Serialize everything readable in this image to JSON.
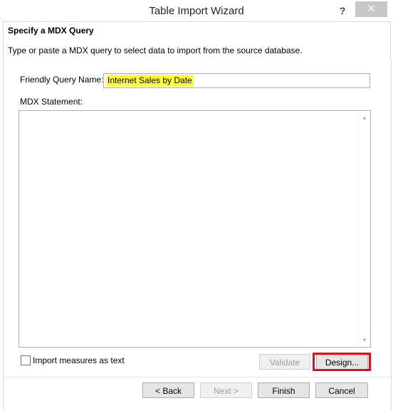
{
  "window": {
    "title": "Table Import Wizard",
    "help_glyph": "?",
    "close_glyph": "✕"
  },
  "header": {
    "title": "Specify a MDX Query",
    "description": "Type or paste a MDX query to select data to import from the source database."
  },
  "form": {
    "friendly_name_label": "Friendly Query Name:",
    "friendly_name_value": "Internet Sales by Date",
    "mdx_label": "MDX Statement:",
    "mdx_value": "",
    "import_measures_label": "Import measures as text",
    "import_measures_checked": false
  },
  "buttons": {
    "validate": "Validate",
    "design": "Design...",
    "back": "< Back",
    "next": "Next >",
    "finish": "Finish",
    "cancel": "Cancel"
  },
  "colors": {
    "highlight_yellow": "#ffff33",
    "annotation_red": "#e0101a"
  }
}
